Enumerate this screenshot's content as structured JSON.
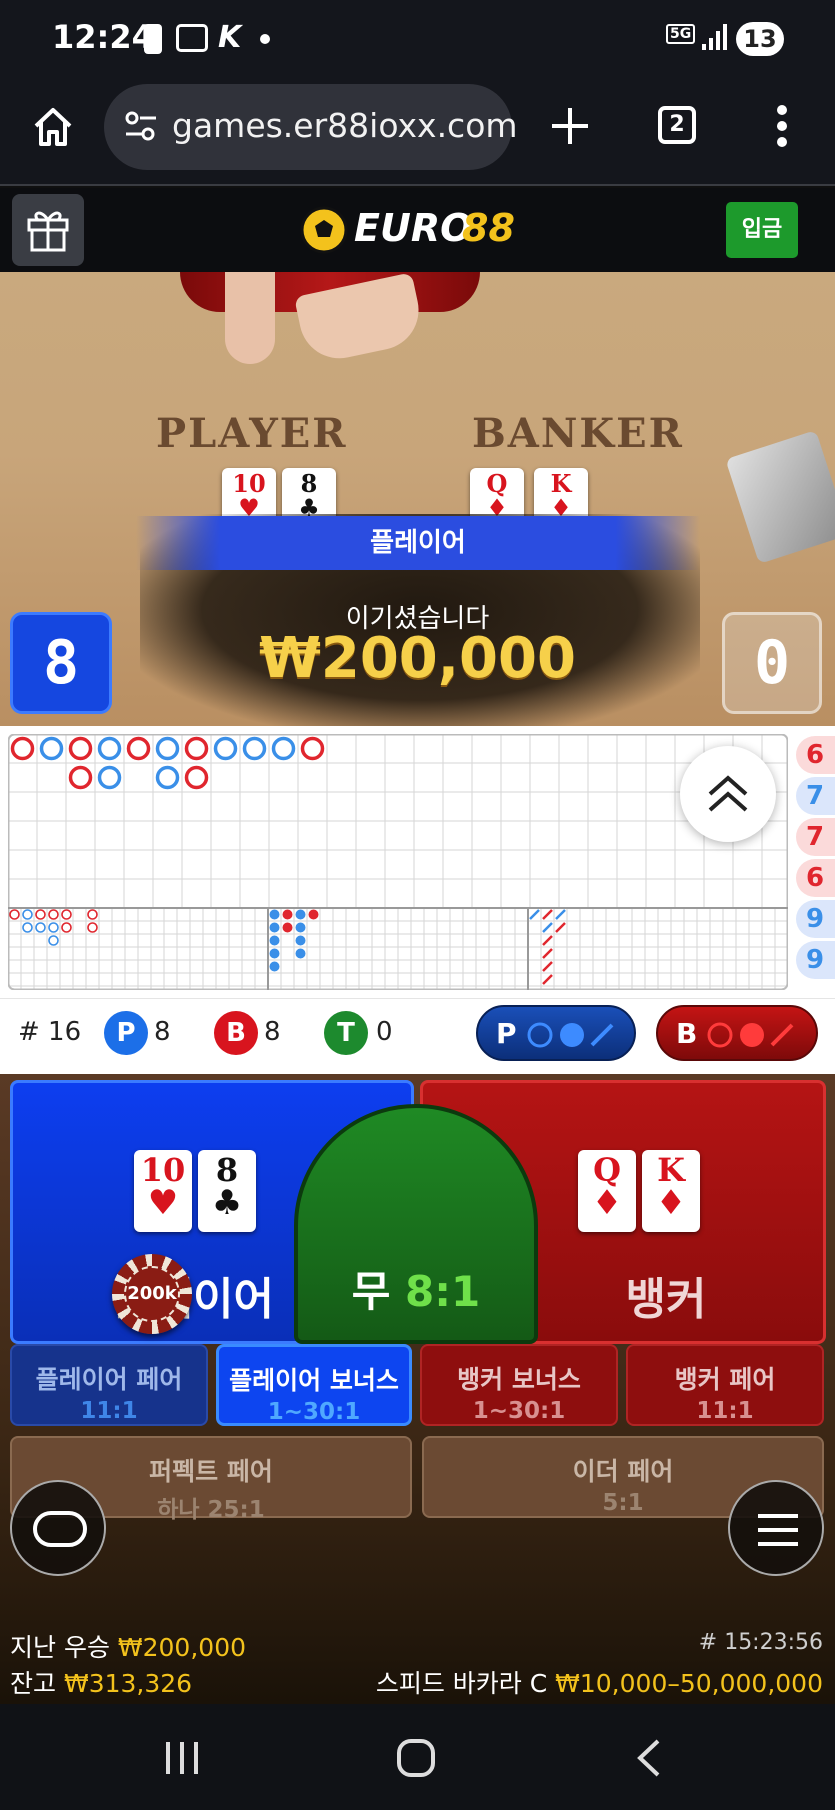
{
  "status": {
    "time": "12:24",
    "badge": "13",
    "network": "5G"
  },
  "browser": {
    "url": "games.er88ioxx.com",
    "tab_count": "2"
  },
  "site": {
    "logo_text_a": "EURO",
    "logo_text_b": "88",
    "deposit_label": "입금"
  },
  "video": {
    "player_label": "PLAYER",
    "banker_label": "BANKER",
    "result_banner": "플레이어",
    "win_text": "이기셨습니다",
    "win_amount": "₩200,000",
    "player_score": "8",
    "banker_score": "0",
    "player_cards": [
      {
        "rank": "10",
        "suit": "♥"
      },
      {
        "rank": "8",
        "suit": "♣"
      }
    ],
    "banker_cards": [
      {
        "rank": "Q",
        "suit": "♦"
      },
      {
        "rank": "K",
        "suit": "♦"
      }
    ]
  },
  "side_numbers": [
    "6",
    "7",
    "7",
    "6",
    "9",
    "9"
  ],
  "stats": {
    "shoe": "# 16",
    "p_letter": "P",
    "p_count": "8",
    "b_letter": "B",
    "b_count": "8",
    "t_letter": "T",
    "t_count": "0",
    "p_predict": "P",
    "b_predict": "B"
  },
  "bets": {
    "player_label": "플레이어",
    "tie_label": "무",
    "tie_odds": "8:1",
    "banker_label": "뱅커",
    "chip_label": "200k",
    "player_cards": [
      {
        "rank": "10",
        "suit": "♥"
      },
      {
        "rank": "8",
        "suit": "♣"
      }
    ],
    "banker_cards": [
      {
        "rank": "Q",
        "suit": "♦"
      },
      {
        "rank": "K",
        "suit": "♦"
      }
    ],
    "side": [
      {
        "title": "플레이어 페어",
        "odds": "11:1"
      },
      {
        "title": "플레이어 보너스",
        "odds": "1~30:1"
      },
      {
        "title": "뱅커 보너스",
        "odds": "1~30:1"
      },
      {
        "title": "뱅커 페어",
        "odds": "11:1"
      }
    ],
    "perfect_pair": {
      "title": "퍼펙트 페어",
      "odds": "하나 25:1"
    },
    "either_pair": {
      "title": "이더 페어",
      "odds": "5:1"
    }
  },
  "footer": {
    "last_win_label": "지난 우승",
    "last_win": "₩200,000",
    "balance_label": "잔고",
    "balance": "₩313,326",
    "round_id": "# 15:23:56",
    "table_name": "스피드 바카라 C",
    "limits": "₩10,000–50,000,000"
  },
  "colors": {
    "player_blue": "#0a36d8",
    "banker_red": "#b01010",
    "tie_green": "#176b1a",
    "gold": "#f3c21c",
    "deposit_green": "#1d9a2c"
  }
}
